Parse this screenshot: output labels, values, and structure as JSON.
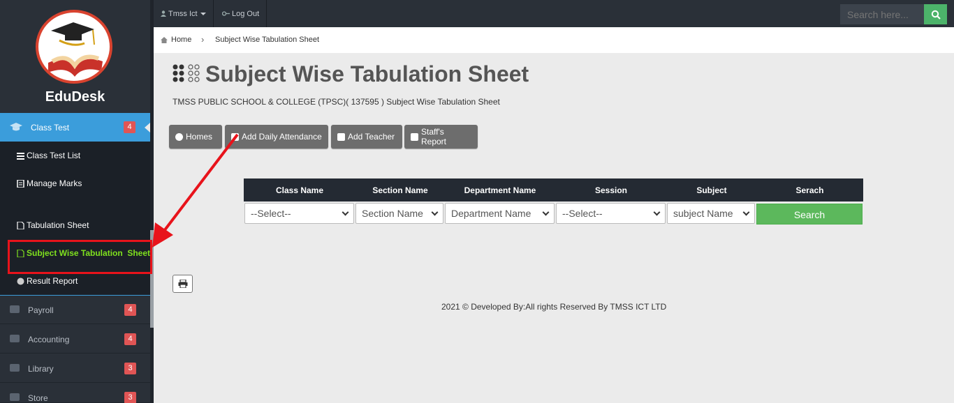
{
  "sidebar": {
    "brand": "EduDesk",
    "active_item": {
      "label": "Class Test",
      "badge": "4"
    },
    "submenu": [
      {
        "label": "Class Test List",
        "icon": "list-icon"
      },
      {
        "label": "Manage Marks",
        "icon": "document-icon"
      },
      {
        "label": "Tabulation Sheet",
        "icon": "file-icon"
      },
      {
        "label": "Subject Wise Tabulation  Sheet",
        "icon": "file-icon",
        "highlighted": true
      },
      {
        "label": "Result Report",
        "icon": "circle-icon"
      }
    ],
    "groups": [
      {
        "label": "Payroll",
        "badge": "4",
        "icon": "money-icon"
      },
      {
        "label": "Accounting",
        "badge": "4",
        "icon": "briefcase-icon"
      },
      {
        "label": "Library",
        "badge": "3",
        "icon": "book-icon"
      },
      {
        "label": "Store",
        "badge": "3",
        "icon": "book-icon"
      }
    ]
  },
  "topbar": {
    "user": "Tmss Ict",
    "logout": "Log Out",
    "search_placeholder": "Search here..."
  },
  "breadcrumb": {
    "home": "Home",
    "current": "Subject Wise Tabulation Sheet"
  },
  "page": {
    "title": "Subject Wise Tabulation Sheet",
    "subtitle": "TMSS PUBLIC SCHOOL & COLLEGE (TPSC)( 137595 ) Subject Wise Tabulation Sheet"
  },
  "actions": {
    "homes": "Homes",
    "add_daily_attendance": "Add Daily Attendance",
    "add_teacher": "Add Teacher",
    "staffs_report": "Staff's Report"
  },
  "filter_table": {
    "headers": [
      "Class Name",
      "Section Name",
      "Department Name",
      "Session",
      "Subject",
      "Serach"
    ],
    "selects": [
      "--Select--",
      "Section Name",
      "Department Name",
      "--Select--",
      "subject Name"
    ],
    "search_button": "Search"
  },
  "footer": "2021 © Developed By:All rights Reserved By TMSS ICT LTD",
  "colors": {
    "sidebar_bg": "#2a3038",
    "active_bg": "#3b9ddb",
    "badge": "#e05555",
    "highlight_text": "#7fe01e",
    "search_green": "#5cb85c",
    "annotation_red": "#e8131b"
  }
}
